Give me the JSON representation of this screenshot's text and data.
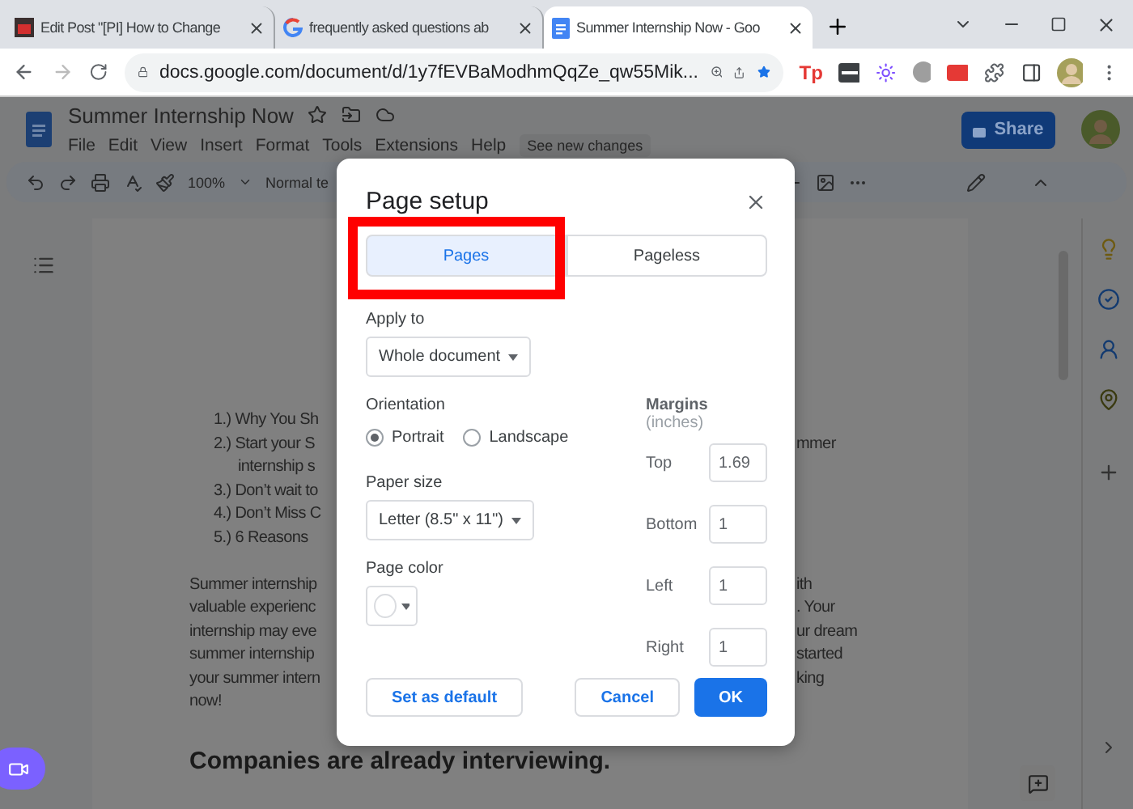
{
  "browser": {
    "tabs": [
      {
        "title": "Edit Post \"[PI] How to Change",
        "kind": "blog",
        "selected": false
      },
      {
        "title": "frequently asked questions ab",
        "kind": "search",
        "selected": false
      },
      {
        "title": "Summer Internship Now - Goo",
        "kind": "docs",
        "selected": true
      }
    ],
    "url": "docs.google.com/document/d/1y7fEVBaModhmQqZe_qw55Mik...",
    "bookmarked": true,
    "extension_label": "Tp"
  },
  "docs": {
    "title": "Summer Internship Now",
    "menus": [
      "File",
      "Edit",
      "View",
      "Insert",
      "Format",
      "Tools",
      "Extensions",
      "Help"
    ],
    "notice": "See new changes",
    "share": "Share",
    "zoom": "100%",
    "style": "Normal te"
  },
  "document": {
    "lines": [
      {
        "kind": "list",
        "left": "1.) Why You Sh"
      },
      {
        "kind": "list",
        "left": "2.) Start your S",
        "right": "mmer"
      },
      {
        "kind": "continuation",
        "left": "internship s"
      },
      {
        "kind": "list",
        "left": "3.) Don’t wait to"
      },
      {
        "kind": "list",
        "left": "4.) Don’t Miss C"
      },
      {
        "kind": "list",
        "left": "5.)  6 Reasons"
      },
      {
        "kind": "body",
        "left": "Summer internship",
        "right": "ith"
      },
      {
        "kind": "body",
        "left": "valuable experienc",
        "right": ". Your"
      },
      {
        "kind": "body",
        "left": "internship may eve",
        "right": "ur dream"
      },
      {
        "kind": "body",
        "left": "summer internship",
        "right": "started"
      },
      {
        "kind": "body",
        "left": "your summer intern",
        "right": "king"
      },
      {
        "kind": "body",
        "left": "now!"
      }
    ],
    "heading": "Companies are already interviewing."
  },
  "dialog": {
    "title": "Page setup",
    "modes": [
      {
        "label": "Pages",
        "selected": true
      },
      {
        "label": "Pageless",
        "selected": false
      }
    ],
    "apply_label": "Apply to",
    "apply_value": "Whole document",
    "orientation_label": "Orientation",
    "orientations": [
      {
        "label": "Portrait",
        "selected": true
      },
      {
        "label": "Landscape",
        "selected": false
      }
    ],
    "paper_label": "Paper size",
    "paper_value": "Letter (8.5\" x 11\")",
    "color_label": "Page color",
    "margins_label": "Margins",
    "margins_unit": "(inches)",
    "margins": [
      {
        "label": "Top",
        "value": "1.69"
      },
      {
        "label": "Bottom",
        "value": "1"
      },
      {
        "label": "Left",
        "value": "1"
      },
      {
        "label": "Right",
        "value": "1"
      }
    ],
    "buttons": [
      {
        "label": "Set as default",
        "kind": "secondary"
      },
      {
        "label": "Cancel",
        "kind": "secondary"
      },
      {
        "label": "OK",
        "kind": "primary"
      }
    ]
  }
}
